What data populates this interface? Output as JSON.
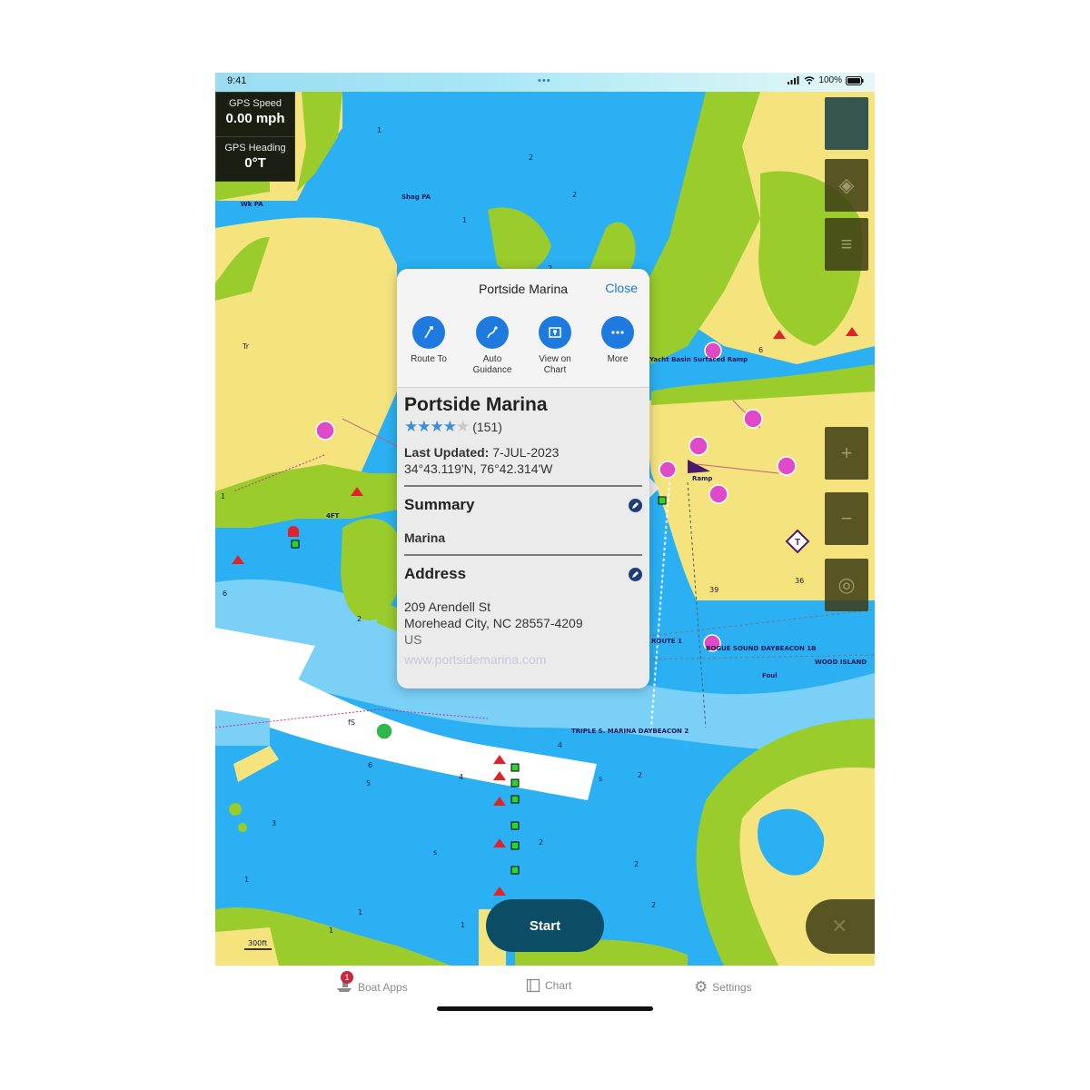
{
  "status_bar": {
    "time": "9:41",
    "dots": "•••",
    "battery": "100%"
  },
  "gps": {
    "speed_label": "GPS Speed",
    "speed_value": "0.00 mph",
    "heading_label": "GPS Heading",
    "heading_value": "0°T"
  },
  "popup": {
    "title": "Portside Marina",
    "close_label": "Close",
    "actions": [
      {
        "label": "Route To",
        "icon": "route-to-icon"
      },
      {
        "label": "Auto Guidance",
        "icon": "auto-guidance-icon"
      },
      {
        "label": "View on Chart",
        "icon": "view-on-chart-icon"
      },
      {
        "label": "More",
        "icon": "more-icon"
      }
    ],
    "name": "Portside Marina",
    "rating_stars": 4,
    "rating_max": 5,
    "rating_count": "(151)",
    "last_updated_label": "Last Updated:",
    "last_updated_value": "7-JUL-2023",
    "coordinates": "34°43.119'N, 76°42.314'W",
    "summary_title": "Summary",
    "summary_value": "Marina",
    "address_title": "Address",
    "address_line1": "209 Arendell St",
    "address_line2": "Morehead City, NC 28557-4209",
    "address_line3": "US",
    "website": "www.portsidemarina.com"
  },
  "start_label": "Start",
  "map_labels": {
    "wk_pa": "Wk PA",
    "shag_pa": "Shag PA",
    "four_ft": "4FT",
    "yacht_basin": "Yacht Basin Surfaced Ramp",
    "ramp": "Ramp",
    "route1": "ROUTE 1",
    "bogue": "BOGUE SOUND DAYBEACON 1B",
    "wood_island": "WOOD ISLAND",
    "foul": "Foul",
    "triple_s": "TRIPLE S. MARINA DAYBEACON 2",
    "scale": "300ft",
    "tr": "Tr",
    "fs": "fS"
  },
  "tabs": [
    {
      "label": "Boat Apps",
      "badge": "1"
    },
    {
      "label": "Chart"
    },
    {
      "label": "Settings"
    }
  ],
  "colors": {
    "water_deep": "#2ab0f3",
    "water_shallow": "#7ad0f6",
    "land": "#f5e37e",
    "marsh": "#9acc2c",
    "accent": "#1f7ae0"
  }
}
